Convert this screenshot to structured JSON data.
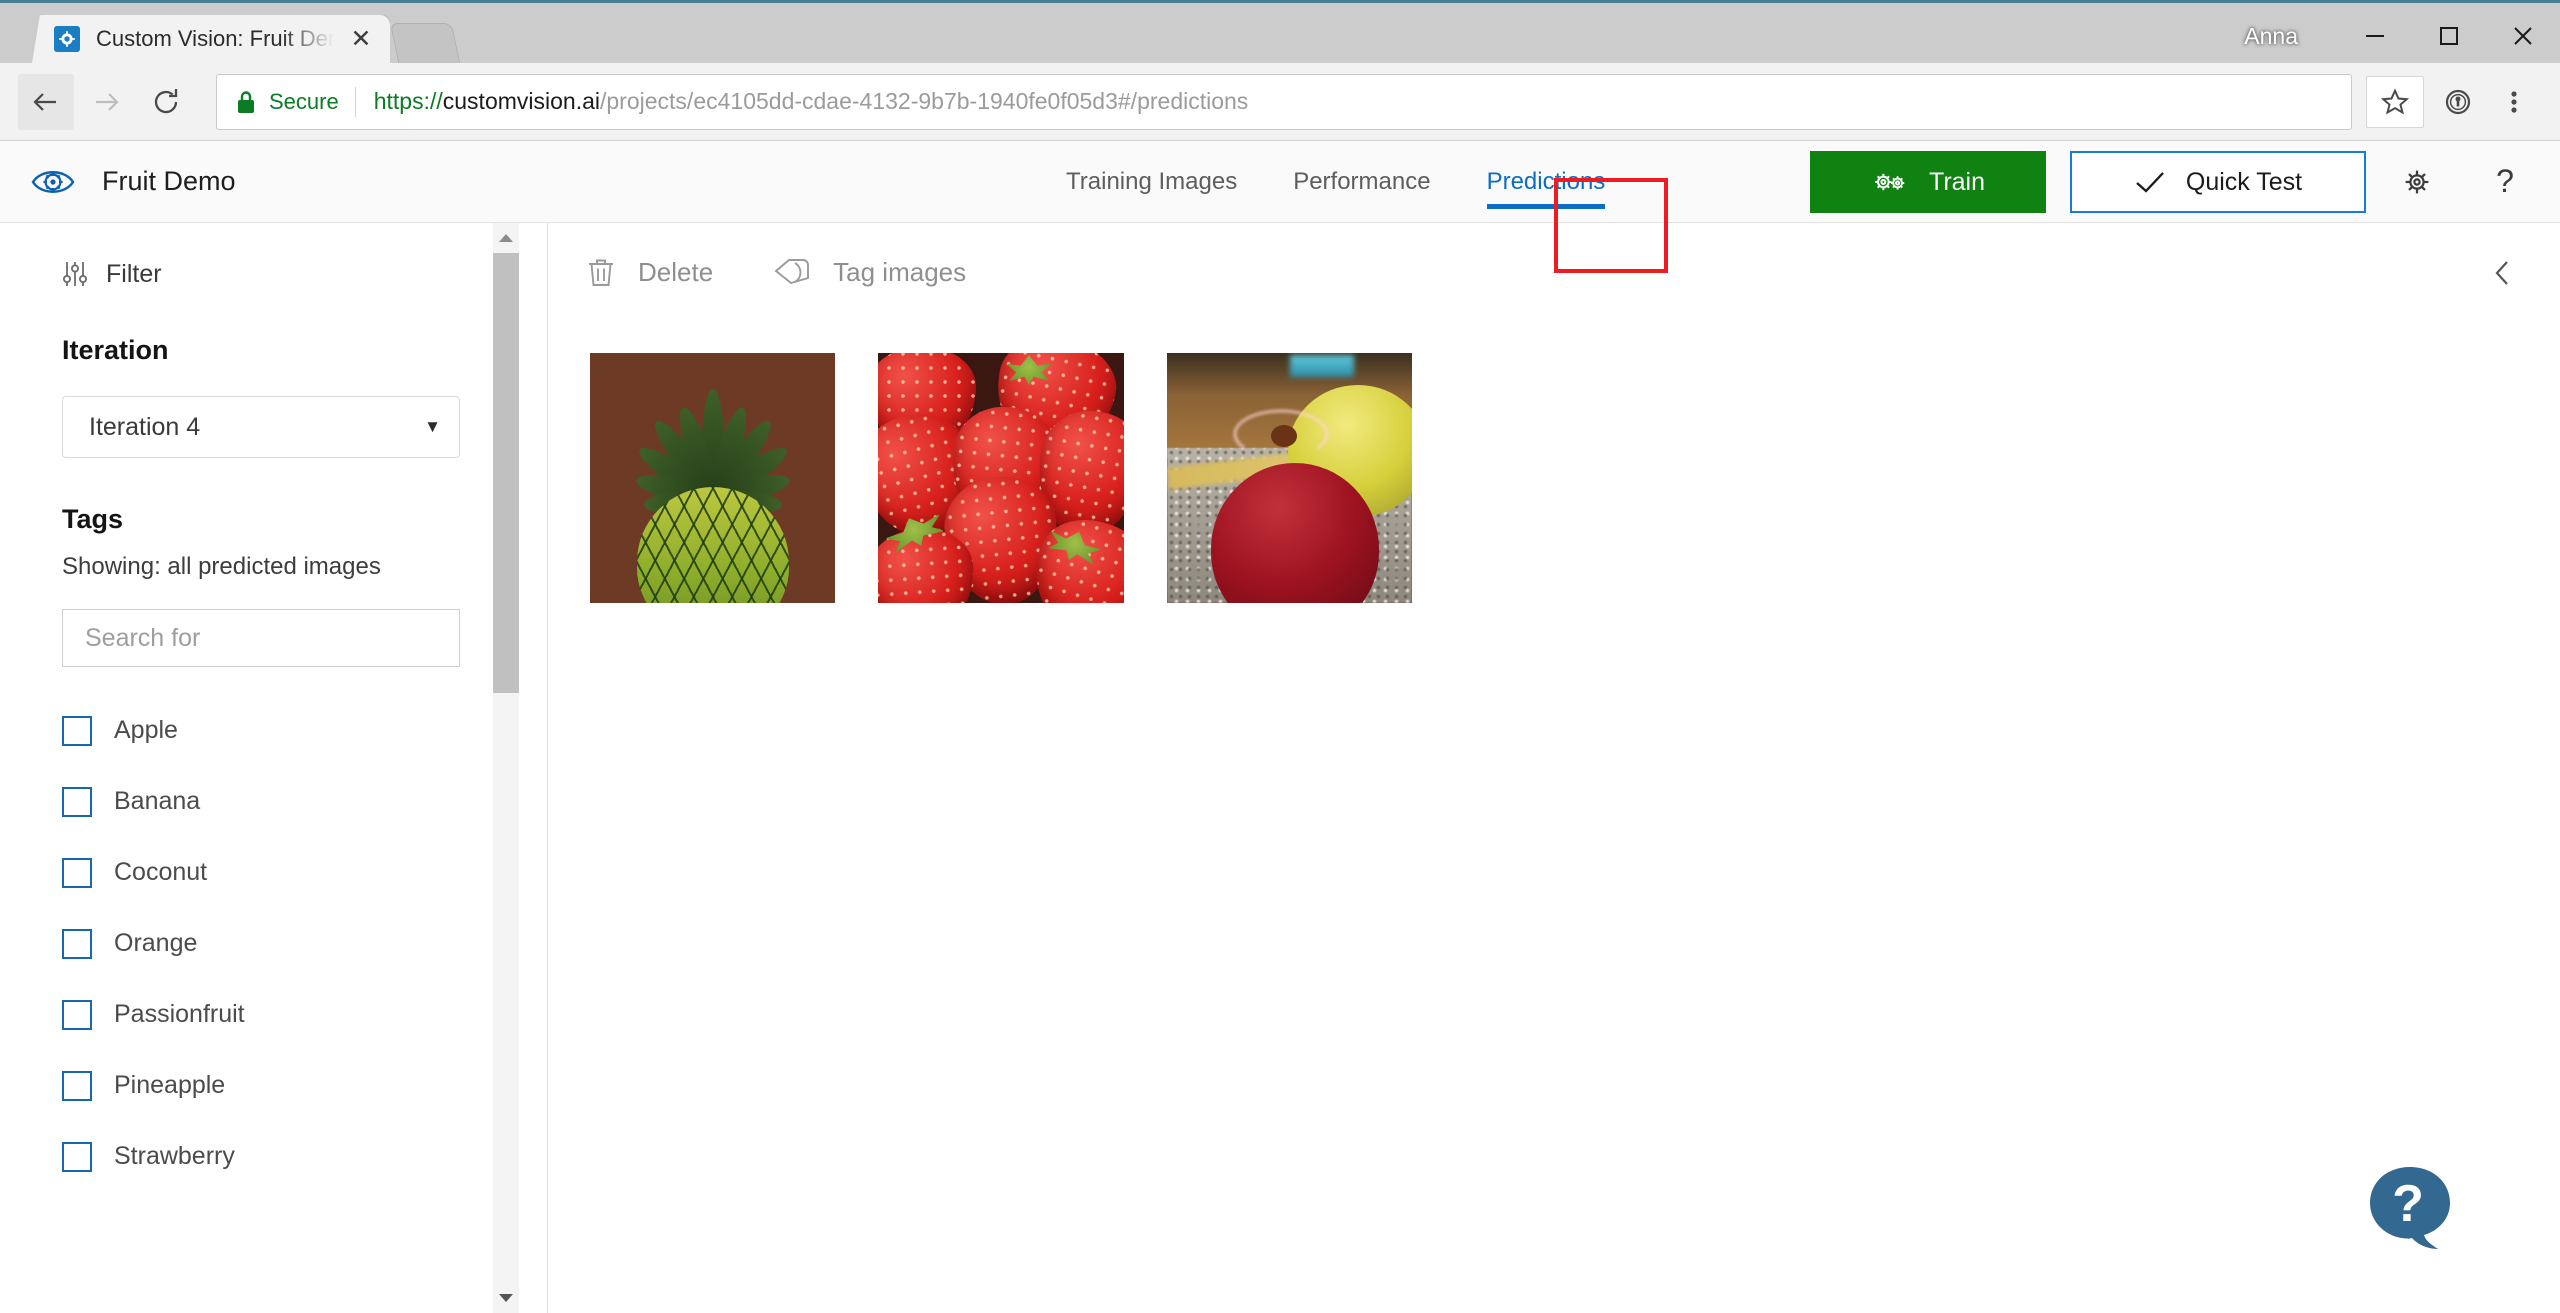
{
  "browser": {
    "tab": {
      "title": "Custom Vision: Fruit Dem",
      "favicon_icon": "custom-vision-icon",
      "close_icon": "close-icon"
    },
    "newtab_icon": "new-tab-icon",
    "profile_name": "Anna",
    "window_controls": {
      "minimize_icon": "minimize-icon",
      "maximize_icon": "maximize-icon",
      "close_icon": "close-icon"
    },
    "nav": {
      "back_icon": "back-arrow-icon",
      "forward_icon": "forward-arrow-icon",
      "reload_icon": "reload-icon"
    },
    "omnibox": {
      "lock_icon": "lock-icon",
      "security_label": "Secure",
      "url_scheme": "https://",
      "url_host": "customvision.ai",
      "url_path": "/projects/ec4105dd-cdae-4132-9b7b-1940fe0f05d3#/predictions",
      "url_full": "https://customvision.ai/projects/ec4105dd-cdae-4132-9b7b-1940fe0f05d3#/predictions",
      "star_icon": "bookmark-star-icon",
      "extension_icon": "password-manager-icon",
      "menu_icon": "chrome-menu-icon"
    }
  },
  "app_header": {
    "logo_icon": "custom-vision-eye-icon",
    "project_name": "Fruit Demo",
    "tabs": [
      {
        "label": "Training Images",
        "active": false
      },
      {
        "label": "Performance",
        "active": false
      },
      {
        "label": "Predictions",
        "active": true
      }
    ],
    "train_button": {
      "label": "Train",
      "icon": "gears-icon",
      "color": "#0f8212"
    },
    "quick_test_button": {
      "label": "Quick Test",
      "icon": "check-icon",
      "border_color": "#1a7ad4"
    },
    "settings_icon": "gear-icon",
    "help_icon": "question-mark-icon",
    "annotation": {
      "target": "Predictions",
      "color": "#ee1c22"
    }
  },
  "sidebar": {
    "filter": {
      "label": "Filter",
      "icon": "sliders-icon"
    },
    "iteration": {
      "title": "Iteration",
      "selected": "Iteration 4",
      "caret_icon": "chevron-down-icon"
    },
    "tags": {
      "title": "Tags",
      "showing_text": "Showing: all predicted images",
      "search_placeholder": "Search for",
      "search_value": "",
      "items": [
        {
          "label": "Apple",
          "checked": false
        },
        {
          "label": "Banana",
          "checked": false
        },
        {
          "label": "Coconut",
          "checked": false
        },
        {
          "label": "Orange",
          "checked": false
        },
        {
          "label": "Passionfruit",
          "checked": false
        },
        {
          "label": "Pineapple",
          "checked": false
        },
        {
          "label": "Strawberry",
          "checked": false
        }
      ]
    },
    "scrollbar": {
      "up_icon": "scroll-up-arrow-icon",
      "down_icon": "scroll-down-arrow-icon"
    }
  },
  "main": {
    "toolbar": {
      "delete": {
        "label": "Delete",
        "icon": "trash-icon",
        "enabled": false
      },
      "tag_images": {
        "label": "Tag images",
        "icon": "tag-icon",
        "enabled": false
      }
    },
    "collapse_icon": "chevron-left-icon",
    "predictions": [
      {
        "name": "pineapple-prediction-thumbnail",
        "alt": "Pineapple on brown background"
      },
      {
        "name": "strawberry-prediction-thumbnail",
        "alt": "Cluster of red strawberries"
      },
      {
        "name": "apple-prediction-thumbnail",
        "alt": "Red apple on kitchen counter"
      }
    ],
    "help_fab": {
      "icon": "help-chat-bubble-icon",
      "color": "#336990",
      "glyph": "?"
    }
  }
}
